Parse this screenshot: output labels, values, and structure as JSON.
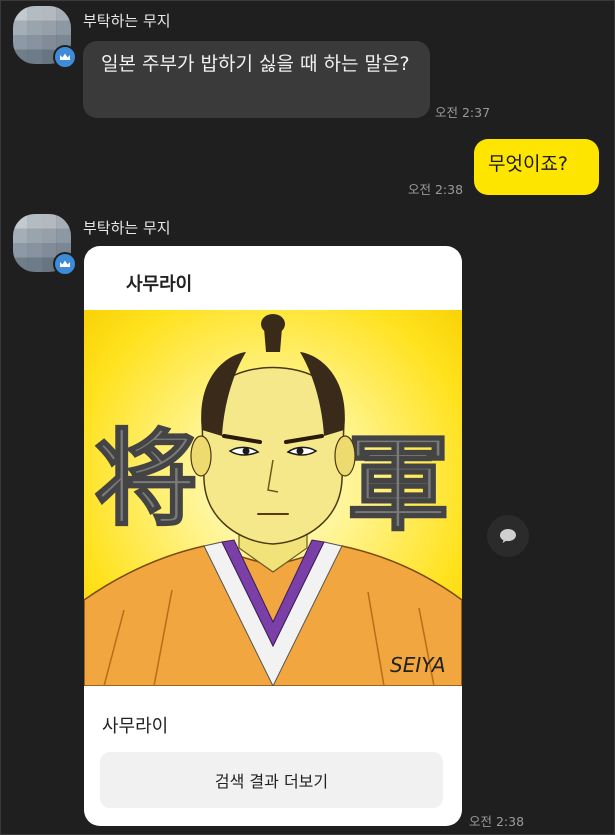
{
  "messages": [
    {
      "sender": "부탁하는 무지",
      "text": "일본 주부가 밥하기 싫을 때 하는 말은?",
      "time": "오전 2:37"
    },
    {
      "text": "무엇이죠?",
      "time": "오전 2:38"
    },
    {
      "sender": "부탁하는 무지",
      "card": {
        "title": "사무라이",
        "caption": "사무라이",
        "button_label": "검색 결과 더보기",
        "image_kanji_left": "将",
        "image_kanji_right": "軍",
        "image_signature": "SEIYA"
      },
      "time": "오전 2:38"
    }
  ],
  "icons": {
    "badge": "crown-badge-icon",
    "share": "speech-bubble-icon"
  },
  "colors": {
    "background": "#1f1f1f",
    "incoming_bubble": "#3a3a3a",
    "outgoing_bubble": "#fee500",
    "badge": "#3d8bd9"
  }
}
